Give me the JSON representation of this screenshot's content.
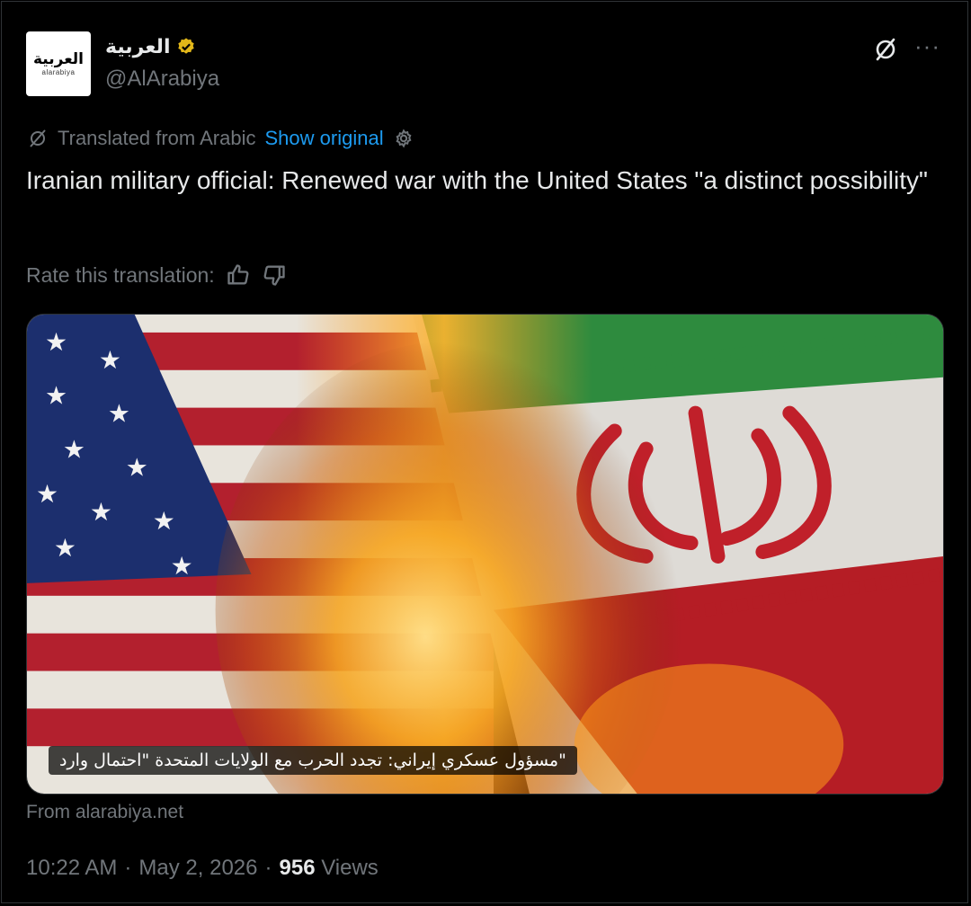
{
  "account": {
    "display_name": "العربية",
    "handle": "@AlArabiya",
    "avatar_text_ar": "العربية",
    "avatar_text_lat": "alarabiya",
    "verified_color": "#e2b719"
  },
  "translation": {
    "note": "Translated from Arabic",
    "show_original": "Show original",
    "rate_label": "Rate this translation:"
  },
  "tweet": {
    "text": "Iranian military official: Renewed war with the United States \"a distinct possibility\""
  },
  "media": {
    "caption": "\"مسؤول عسكري إيراني: تجدد الحرب مع الولايات المتحدة \"احتمال وارد"
  },
  "source": "From alarabiya.net",
  "meta": {
    "time": "10:22 AM",
    "date": "May 2, 2026",
    "separator": "·",
    "views_count": "956",
    "views_label": "Views"
  },
  "icons": {
    "grok": "grok-icon",
    "more": "more-icon",
    "translate": "translate-icon",
    "settings": "gear-icon",
    "thumbs_up": "thumbs-up-icon",
    "thumbs_down": "thumbs-down-icon"
  },
  "colors": {
    "background": "#000000",
    "text": "#e7e9ea",
    "muted": "#71767b",
    "link": "#1d9bf0"
  }
}
